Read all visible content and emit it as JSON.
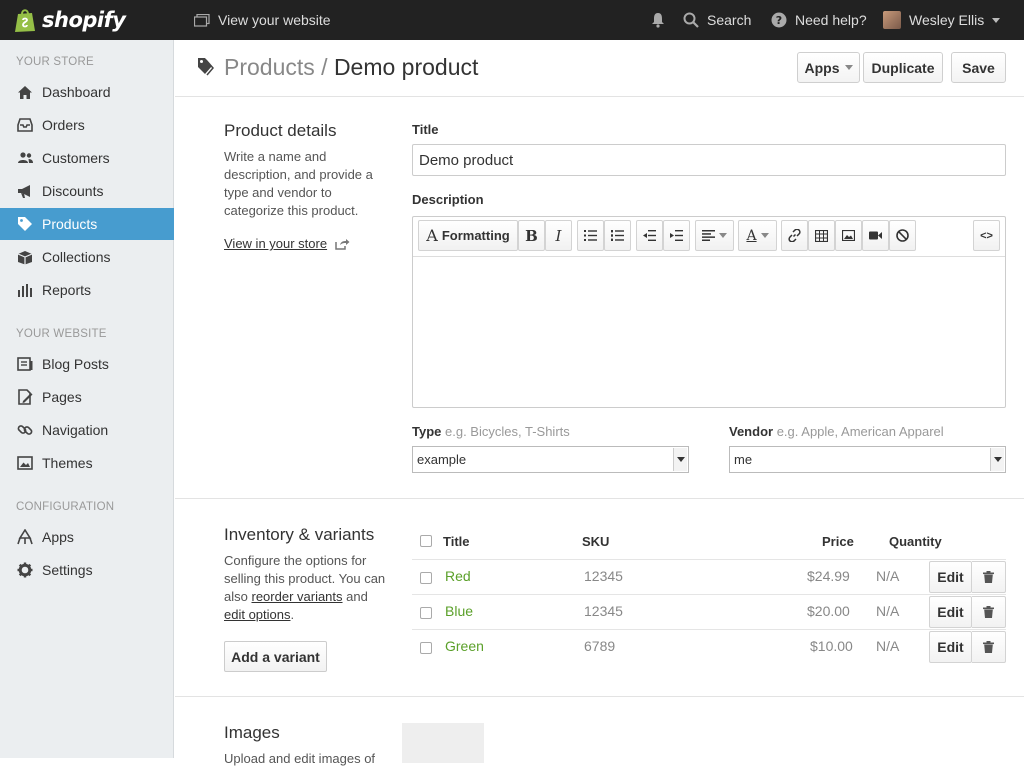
{
  "topbar": {
    "brand": "shopify",
    "view_site": "View your website",
    "search": "Search",
    "help": "Need help?",
    "user": "Wesley Ellis"
  },
  "sidebar": {
    "sections": [
      {
        "title": "YOUR STORE",
        "items": [
          {
            "label": "Dashboard",
            "icon": "home-icon"
          },
          {
            "label": "Orders",
            "icon": "inbox-icon"
          },
          {
            "label": "Customers",
            "icon": "users-icon"
          },
          {
            "label": "Discounts",
            "icon": "megaphone-icon"
          },
          {
            "label": "Products",
            "icon": "tag-icon",
            "active": true
          },
          {
            "label": "Collections",
            "icon": "box-icon"
          },
          {
            "label": "Reports",
            "icon": "bar-chart-icon"
          }
        ]
      },
      {
        "title": "YOUR WEBSITE",
        "items": [
          {
            "label": "Blog Posts",
            "icon": "blog-icon"
          },
          {
            "label": "Pages",
            "icon": "pages-icon"
          },
          {
            "label": "Navigation",
            "icon": "chain-link-icon"
          },
          {
            "label": "Themes",
            "icon": "image-icon"
          }
        ]
      },
      {
        "title": "CONFIGURATION",
        "items": [
          {
            "label": "Apps",
            "icon": "apps-icon"
          },
          {
            "label": "Settings",
            "icon": "gear-icon"
          }
        ]
      }
    ]
  },
  "header": {
    "breadcrumb_parent": "Products",
    "separator": " / ",
    "title": "Demo product",
    "apps_label": "Apps",
    "duplicate_label": "Duplicate",
    "save_label": "Save"
  },
  "details": {
    "heading": "Product details",
    "description": "Write a name and description, and provide a type and vendor to categorize this product.",
    "view_link": "View in your store",
    "title_label": "Title",
    "title_value": "Demo product",
    "description_label": "Description",
    "formatting_label": "Formatting",
    "html_label": "<>",
    "type_label": "Type",
    "type_hint": "e.g. Bicycles, T-Shirts",
    "type_value": "example",
    "vendor_label": "Vendor",
    "vendor_hint": "e.g. Apple, American Apparel",
    "vendor_value": "me"
  },
  "inventory": {
    "heading": "Inventory & variants",
    "desc_1": "Configure the options for selling this product. You can also",
    "reorder_link": "reorder variants",
    "desc_and": "and",
    "edit_options_link": "edit options",
    "desc_end": ".",
    "add_variant_label": "Add a variant",
    "columns": {
      "title": "Title",
      "sku": "SKU",
      "price": "Price",
      "quantity": "Quantity"
    },
    "edit_label": "Edit",
    "rows": [
      {
        "title": "Red",
        "sku": "12345",
        "price": "$24.99",
        "quantity": "N/A"
      },
      {
        "title": "Blue",
        "sku": "12345",
        "price": "$20.00",
        "quantity": "N/A"
      },
      {
        "title": "Green",
        "sku": "6789",
        "price": "$10.00",
        "quantity": "N/A"
      }
    ]
  },
  "images": {
    "heading": "Images",
    "desc": "Upload and edit images of"
  },
  "colors": {
    "topbar": "#222222",
    "sidebar": "#ebeef0",
    "active": "#479ccf",
    "variant_link": "#5ba02a"
  }
}
